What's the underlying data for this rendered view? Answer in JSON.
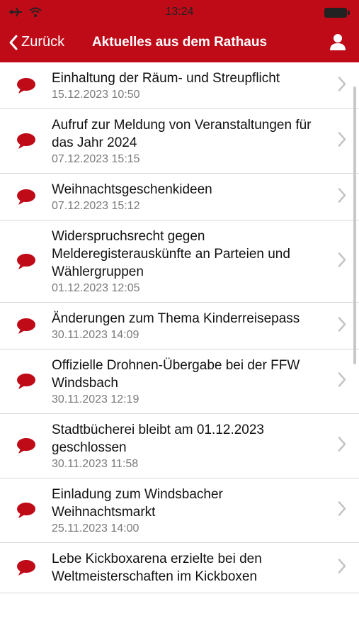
{
  "status_bar": {
    "time": "13:24"
  },
  "nav": {
    "back_label": "Zurück",
    "title": "Aktuelles aus dem Rathaus"
  },
  "items": [
    {
      "title": "Einhaltung der Räum- und Streupflicht",
      "date": "15.12.2023 10:50"
    },
    {
      "title": "Aufruf zur Meldung von Veranstaltungen für das Jahr 2024",
      "date": "07.12.2023 15:15"
    },
    {
      "title": "Weihnachtsgeschenkideen",
      "date": "07.12.2023 15:12"
    },
    {
      "title": "Widerspruchsrecht gegen Melderegisterauskünfte an Parteien und Wählergruppen",
      "date": "01.12.2023 12:05"
    },
    {
      "title": "Änderungen zum Thema Kinderreisepass",
      "date": "30.11.2023 14:09"
    },
    {
      "title": "Offizielle Drohnen-Übergabe bei der FFW Windsbach",
      "date": "30.11.2023 12:19"
    },
    {
      "title": "Stadtbücherei bleibt am 01.12.2023 geschlossen",
      "date": "30.11.2023 11:58"
    },
    {
      "title": "Einladung zum Windsbacher Weihnachtsmarkt",
      "date": "25.11.2023 14:00"
    },
    {
      "title": "Lebe Kickboxarena erzielte bei den Weltmeisterschaften im Kickboxen",
      "date": ""
    }
  ],
  "colors": {
    "accent": "#bf0a18"
  }
}
